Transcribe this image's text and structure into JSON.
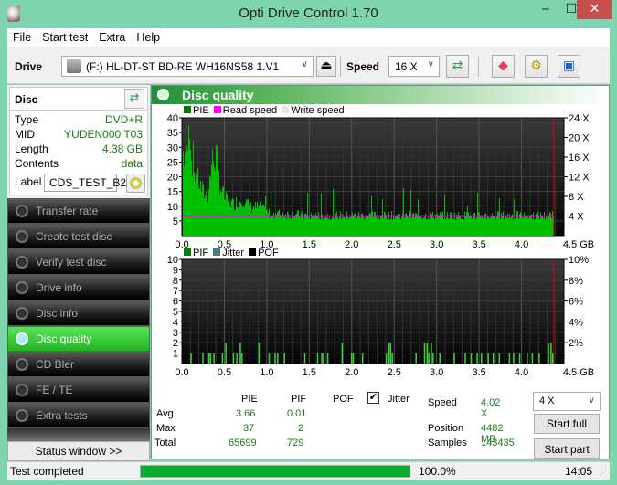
{
  "window": {
    "title": "Opti Drive Control 1.70",
    "min_label": "‒",
    "max_label": "☐",
    "close_label": "✕"
  },
  "menu": [
    "File",
    "Start test",
    "Extra",
    "Help"
  ],
  "toolbar": {
    "drive_label": "Drive",
    "drive_value": "(F:)  HL-DT-ST BD-RE  WH16NS58 1.V1",
    "speed_label": "Speed",
    "speed_value": "16 X",
    "icons": [
      "eject-icon",
      "refresh-icon",
      "erase-icon",
      "settings-icon",
      "save-icon"
    ]
  },
  "disc": {
    "header": "Disc",
    "rows": [
      {
        "key": "Type",
        "value": "DVD+R"
      },
      {
        "key": "MID",
        "value": "YUDEN000 T03"
      },
      {
        "key": "Length",
        "value": "4.38 GB"
      },
      {
        "key": "Contents",
        "value": "data"
      }
    ],
    "label_key": "Label",
    "label_value": "CDS_TEST_B2"
  },
  "nav": [
    {
      "label": "Transfer rate",
      "active": false
    },
    {
      "label": "Create test disc",
      "active": false
    },
    {
      "label": "Verify test disc",
      "active": false
    },
    {
      "label": "Drive info",
      "active": false
    },
    {
      "label": "Disc info",
      "active": false
    },
    {
      "label": "Disc quality",
      "active": true
    },
    {
      "label": "CD Bler",
      "active": false
    },
    {
      "label": "FE / TE",
      "active": false
    },
    {
      "label": "Extra tests",
      "active": false
    }
  ],
  "status_window_button": "Status window >>",
  "panel_title": "Disc quality",
  "colors": {
    "pie": "#00c000",
    "pif": "#3ad43a",
    "read_speed": "#ff00ff",
    "end_marker": "#e00000",
    "legend_pie": "#008000",
    "legend_jitter": "#408080",
    "legend_pof": "#000000",
    "legend_write": "#e8e8e8",
    "progress": "#06ad2e"
  },
  "chart_data": [
    {
      "type": "bar",
      "title": "PIE / Read speed",
      "legend": [
        "PIE",
        "Read speed",
        "Write speed"
      ],
      "xlabel": "GB",
      "x_ticks": [
        "0.0",
        "0.5",
        "1.0",
        "1.5",
        "2.0",
        "2.5",
        "3.0",
        "3.5",
        "4.0",
        "4.5 GB"
      ],
      "xlim": [
        0,
        4.5
      ],
      "y_ticks": [
        "5",
        "10",
        "15",
        "20",
        "25",
        "30",
        "35",
        "40"
      ],
      "ylim": [
        0,
        40
      ],
      "y2_ticks": [
        "4 X",
        "8 X",
        "12 X",
        "16 X",
        "20 X",
        "24 X"
      ],
      "y2lim": [
        0,
        24
      ],
      "data_end_gb": 4.38,
      "pie_profile": [
        {
          "x": 0.0,
          "y": 30
        },
        {
          "x": 0.05,
          "y": 29
        },
        {
          "x": 0.08,
          "y": 37
        },
        {
          "x": 0.1,
          "y": 26
        },
        {
          "x": 0.15,
          "y": 22
        },
        {
          "x": 0.2,
          "y": 18
        },
        {
          "x": 0.25,
          "y": 15
        },
        {
          "x": 0.3,
          "y": 14
        },
        {
          "x": 0.35,
          "y": 26
        },
        {
          "x": 0.4,
          "y": 28
        },
        {
          "x": 0.45,
          "y": 17
        },
        {
          "x": 0.5,
          "y": 13
        },
        {
          "x": 0.6,
          "y": 11
        },
        {
          "x": 0.7,
          "y": 13
        },
        {
          "x": 0.8,
          "y": 10
        },
        {
          "x": 0.9,
          "y": 10
        },
        {
          "x": 1.0,
          "y": 8
        },
        {
          "x": 1.5,
          "y": 7
        },
        {
          "x": 2.0,
          "y": 7
        },
        {
          "x": 2.5,
          "y": 7
        },
        {
          "x": 3.0,
          "y": 7
        },
        {
          "x": 3.5,
          "y": 7
        },
        {
          "x": 4.0,
          "y": 7
        },
        {
          "x": 4.38,
          "y": 7
        }
      ],
      "read_speed_x": 4.0
    },
    {
      "type": "bar",
      "title": "PIF / Jitter / POF",
      "legend": [
        "PIF",
        "Jitter",
        "POF"
      ],
      "xlabel": "GB",
      "x_ticks": [
        "0.0",
        "0.5",
        "1.0",
        "1.5",
        "2.0",
        "2.5",
        "3.0",
        "3.5",
        "4.0",
        "4.5 GB"
      ],
      "xlim": [
        0,
        4.5
      ],
      "y_ticks": [
        "1",
        "2",
        "3",
        "4",
        "5",
        "6",
        "7",
        "8",
        "9",
        "10"
      ],
      "ylim": [
        0,
        10
      ],
      "y2_ticks": [
        "2%",
        "4%",
        "6%",
        "8%",
        "10%"
      ],
      "y2lim": [
        0,
        10
      ],
      "data_end_gb": 4.38,
      "pif_points": [
        {
          "x": 0.1,
          "y": 1
        },
        {
          "x": 0.24,
          "y": 1
        },
        {
          "x": 0.31,
          "y": 1
        },
        {
          "x": 0.33,
          "y": 1
        },
        {
          "x": 0.37,
          "y": 1
        },
        {
          "x": 0.47,
          "y": 1
        },
        {
          "x": 0.51,
          "y": 2
        },
        {
          "x": 0.6,
          "y": 1
        },
        {
          "x": 0.64,
          "y": 1
        },
        {
          "x": 0.68,
          "y": 2
        },
        {
          "x": 0.7,
          "y": 1
        },
        {
          "x": 0.9,
          "y": 2
        },
        {
          "x": 1.02,
          "y": 1
        },
        {
          "x": 1.09,
          "y": 1
        },
        {
          "x": 1.12,
          "y": 1
        },
        {
          "x": 1.2,
          "y": 1
        },
        {
          "x": 1.44,
          "y": 1
        },
        {
          "x": 1.59,
          "y": 1
        },
        {
          "x": 1.64,
          "y": 1
        },
        {
          "x": 1.66,
          "y": 1
        },
        {
          "x": 1.71,
          "y": 1
        },
        {
          "x": 1.88,
          "y": 2
        },
        {
          "x": 1.99,
          "y": 1
        },
        {
          "x": 2.01,
          "y": 1
        },
        {
          "x": 2.12,
          "y": 1
        },
        {
          "x": 2.4,
          "y": 1
        },
        {
          "x": 2.43,
          "y": 2
        },
        {
          "x": 2.45,
          "y": 2
        },
        {
          "x": 2.47,
          "y": 1
        },
        {
          "x": 2.75,
          "y": 1
        },
        {
          "x": 2.85,
          "y": 2
        },
        {
          "x": 2.88,
          "y": 2
        },
        {
          "x": 2.9,
          "y": 1
        },
        {
          "x": 2.93,
          "y": 2
        },
        {
          "x": 2.95,
          "y": 1
        },
        {
          "x": 3.03,
          "y": 1
        },
        {
          "x": 3.2,
          "y": 1
        },
        {
          "x": 3.33,
          "y": 1
        },
        {
          "x": 3.4,
          "y": 1
        },
        {
          "x": 3.47,
          "y": 1
        },
        {
          "x": 3.52,
          "y": 1
        },
        {
          "x": 3.6,
          "y": 1
        },
        {
          "x": 3.66,
          "y": 1
        },
        {
          "x": 3.73,
          "y": 1
        },
        {
          "x": 3.85,
          "y": 1
        },
        {
          "x": 3.9,
          "y": 1
        },
        {
          "x": 3.97,
          "y": 1
        },
        {
          "x": 4.06,
          "y": 1
        },
        {
          "x": 4.12,
          "y": 1
        },
        {
          "x": 4.2,
          "y": 1
        },
        {
          "x": 4.31,
          "y": 2
        },
        {
          "x": 4.34,
          "y": 2
        },
        {
          "x": 4.36,
          "y": 1
        }
      ]
    }
  ],
  "stats": {
    "headers": [
      "PIE",
      "PIF",
      "POF"
    ],
    "jitter_label": "Jitter",
    "jitter_checked": true,
    "rows": [
      {
        "label": "Avg",
        "pie": "3.66",
        "pif": "0.01"
      },
      {
        "label": "Max",
        "pie": "37",
        "pif": "2"
      },
      {
        "label": "Total",
        "pie": "65699",
        "pif": "729"
      }
    ],
    "speed_label": "Speed",
    "speed_value": "4.02 X",
    "position_label": "Position",
    "position_value": "4482 MB",
    "samples_label": "Samples",
    "samples_value": "143435",
    "speed_select": "4 X",
    "start_full": "Start full",
    "start_part": "Start part"
  },
  "statusbar": {
    "text": "Test completed",
    "progress_percent": 100.0,
    "progress_label": "100.0%",
    "time": "14:05"
  }
}
